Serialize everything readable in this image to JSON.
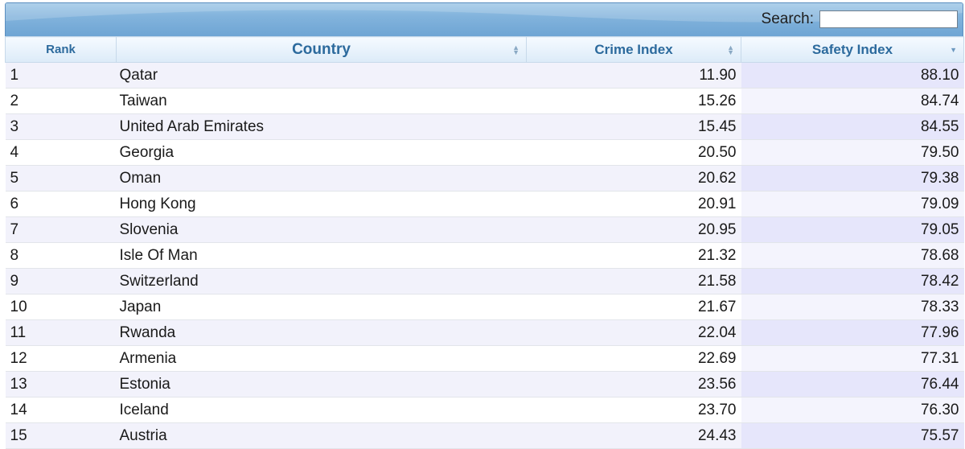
{
  "toolbar": {
    "search_label": "Search:",
    "search_value": ""
  },
  "columns": [
    {
      "key": "rank",
      "label": "Rank",
      "sort": "none"
    },
    {
      "key": "country",
      "label": "Country",
      "sort": "both"
    },
    {
      "key": "crime",
      "label": "Crime Index",
      "sort": "both"
    },
    {
      "key": "safety",
      "label": "Safety Index",
      "sort": "desc"
    }
  ],
  "rows": [
    {
      "rank": "1",
      "country": "Qatar",
      "crime": "11.90",
      "safety": "88.10"
    },
    {
      "rank": "2",
      "country": "Taiwan",
      "crime": "15.26",
      "safety": "84.74"
    },
    {
      "rank": "3",
      "country": "United Arab Emirates",
      "crime": "15.45",
      "safety": "84.55"
    },
    {
      "rank": "4",
      "country": "Georgia",
      "crime": "20.50",
      "safety": "79.50"
    },
    {
      "rank": "5",
      "country": "Oman",
      "crime": "20.62",
      "safety": "79.38"
    },
    {
      "rank": "6",
      "country": "Hong Kong",
      "crime": "20.91",
      "safety": "79.09"
    },
    {
      "rank": "7",
      "country": "Slovenia",
      "crime": "20.95",
      "safety": "79.05"
    },
    {
      "rank": "8",
      "country": "Isle Of Man",
      "crime": "21.32",
      "safety": "78.68"
    },
    {
      "rank": "9",
      "country": "Switzerland",
      "crime": "21.58",
      "safety": "78.42"
    },
    {
      "rank": "10",
      "country": "Japan",
      "crime": "21.67",
      "safety": "78.33"
    },
    {
      "rank": "11",
      "country": "Rwanda",
      "crime": "22.04",
      "safety": "77.96"
    },
    {
      "rank": "12",
      "country": "Armenia",
      "crime": "22.69",
      "safety": "77.31"
    },
    {
      "rank": "13",
      "country": "Estonia",
      "crime": "23.56",
      "safety": "76.44"
    },
    {
      "rank": "14",
      "country": "Iceland",
      "crime": "23.70",
      "safety": "76.30"
    },
    {
      "rank": "15",
      "country": "Austria",
      "crime": "24.43",
      "safety": "75.57"
    }
  ],
  "colors": {
    "toolbar": "#82b3dc",
    "header_text": "#2c6a9d",
    "row_odd": "#f2f2fb",
    "row_even": "#ffffff",
    "sorted_odd": "#e6e6fb",
    "sorted_even": "#f4f4fd"
  }
}
